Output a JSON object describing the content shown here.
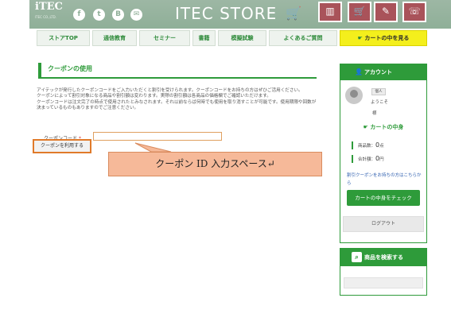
{
  "header": {
    "logo": "iTEC",
    "logo_sub": "ITEC CO.,LTD.",
    "store_title": "ITEC STORE",
    "social_icons": [
      "facebook-icon",
      "twitter-icon",
      "hatena-icon",
      "mail-icon"
    ],
    "buttons": [
      {
        "name": "building-icon",
        "glyph": "▥"
      },
      {
        "name": "cart-icon",
        "glyph": "🛒"
      },
      {
        "name": "pencil-icon",
        "glyph": "✎"
      },
      {
        "name": "phone-icon",
        "glyph": "☏"
      }
    ]
  },
  "nav": {
    "items": [
      "ストアTOP",
      "通信教育",
      "セミナー",
      "書籍",
      "模擬試験",
      "よくあるご質問"
    ],
    "cart_view": "カートの中を見る"
  },
  "main": {
    "title": "クーポンの使用",
    "description": "アイテックが発行したクーポンコードをご入力いただくと割引を受けられます。クーポンコードをお持ちの方はぜひご活用ください。\nクーポンによって割引対象になる商品や割引額は変わります。実際の割引額は各商品の価格欄でご確認いただけます。\nクーポンコードは注文完了の時点で使用されたとみなされます。それ以前ならば何時でも使用を取り消すことが可能です。使用期限や回数が決まっているものもありますのでご注意ください。",
    "coupon_label": "クーポンコード",
    "required_mark": "*",
    "coupon_value": "",
    "use_button": "クーポンを利用する",
    "callout": "クーポン ID 入力スペース↵"
  },
  "sidebar": {
    "account_title": "アカウント",
    "guest_tag": "個人",
    "welcome": "ようこそ",
    "honorific": "様",
    "cart_title": "カートの中身",
    "item_count_label": "商品数：",
    "item_count": "0",
    "item_count_unit": "点",
    "total_label": "合計額：",
    "total": "0",
    "total_unit": "円",
    "coupon_link": "割引クーポンをお持ちの方はこちらから",
    "check_cart_button": "カートの中身をチェック",
    "logout_button": "ログアウト",
    "search_title": "商品を検索する"
  },
  "colors": {
    "brand_green": "#2e9b3a",
    "header_green": "#8faf98",
    "nav_yellow": "#f4ef1c",
    "header_button": "#a9535a",
    "callout_fill": "#f6b999",
    "highlight_orange": "#e07a2a"
  }
}
